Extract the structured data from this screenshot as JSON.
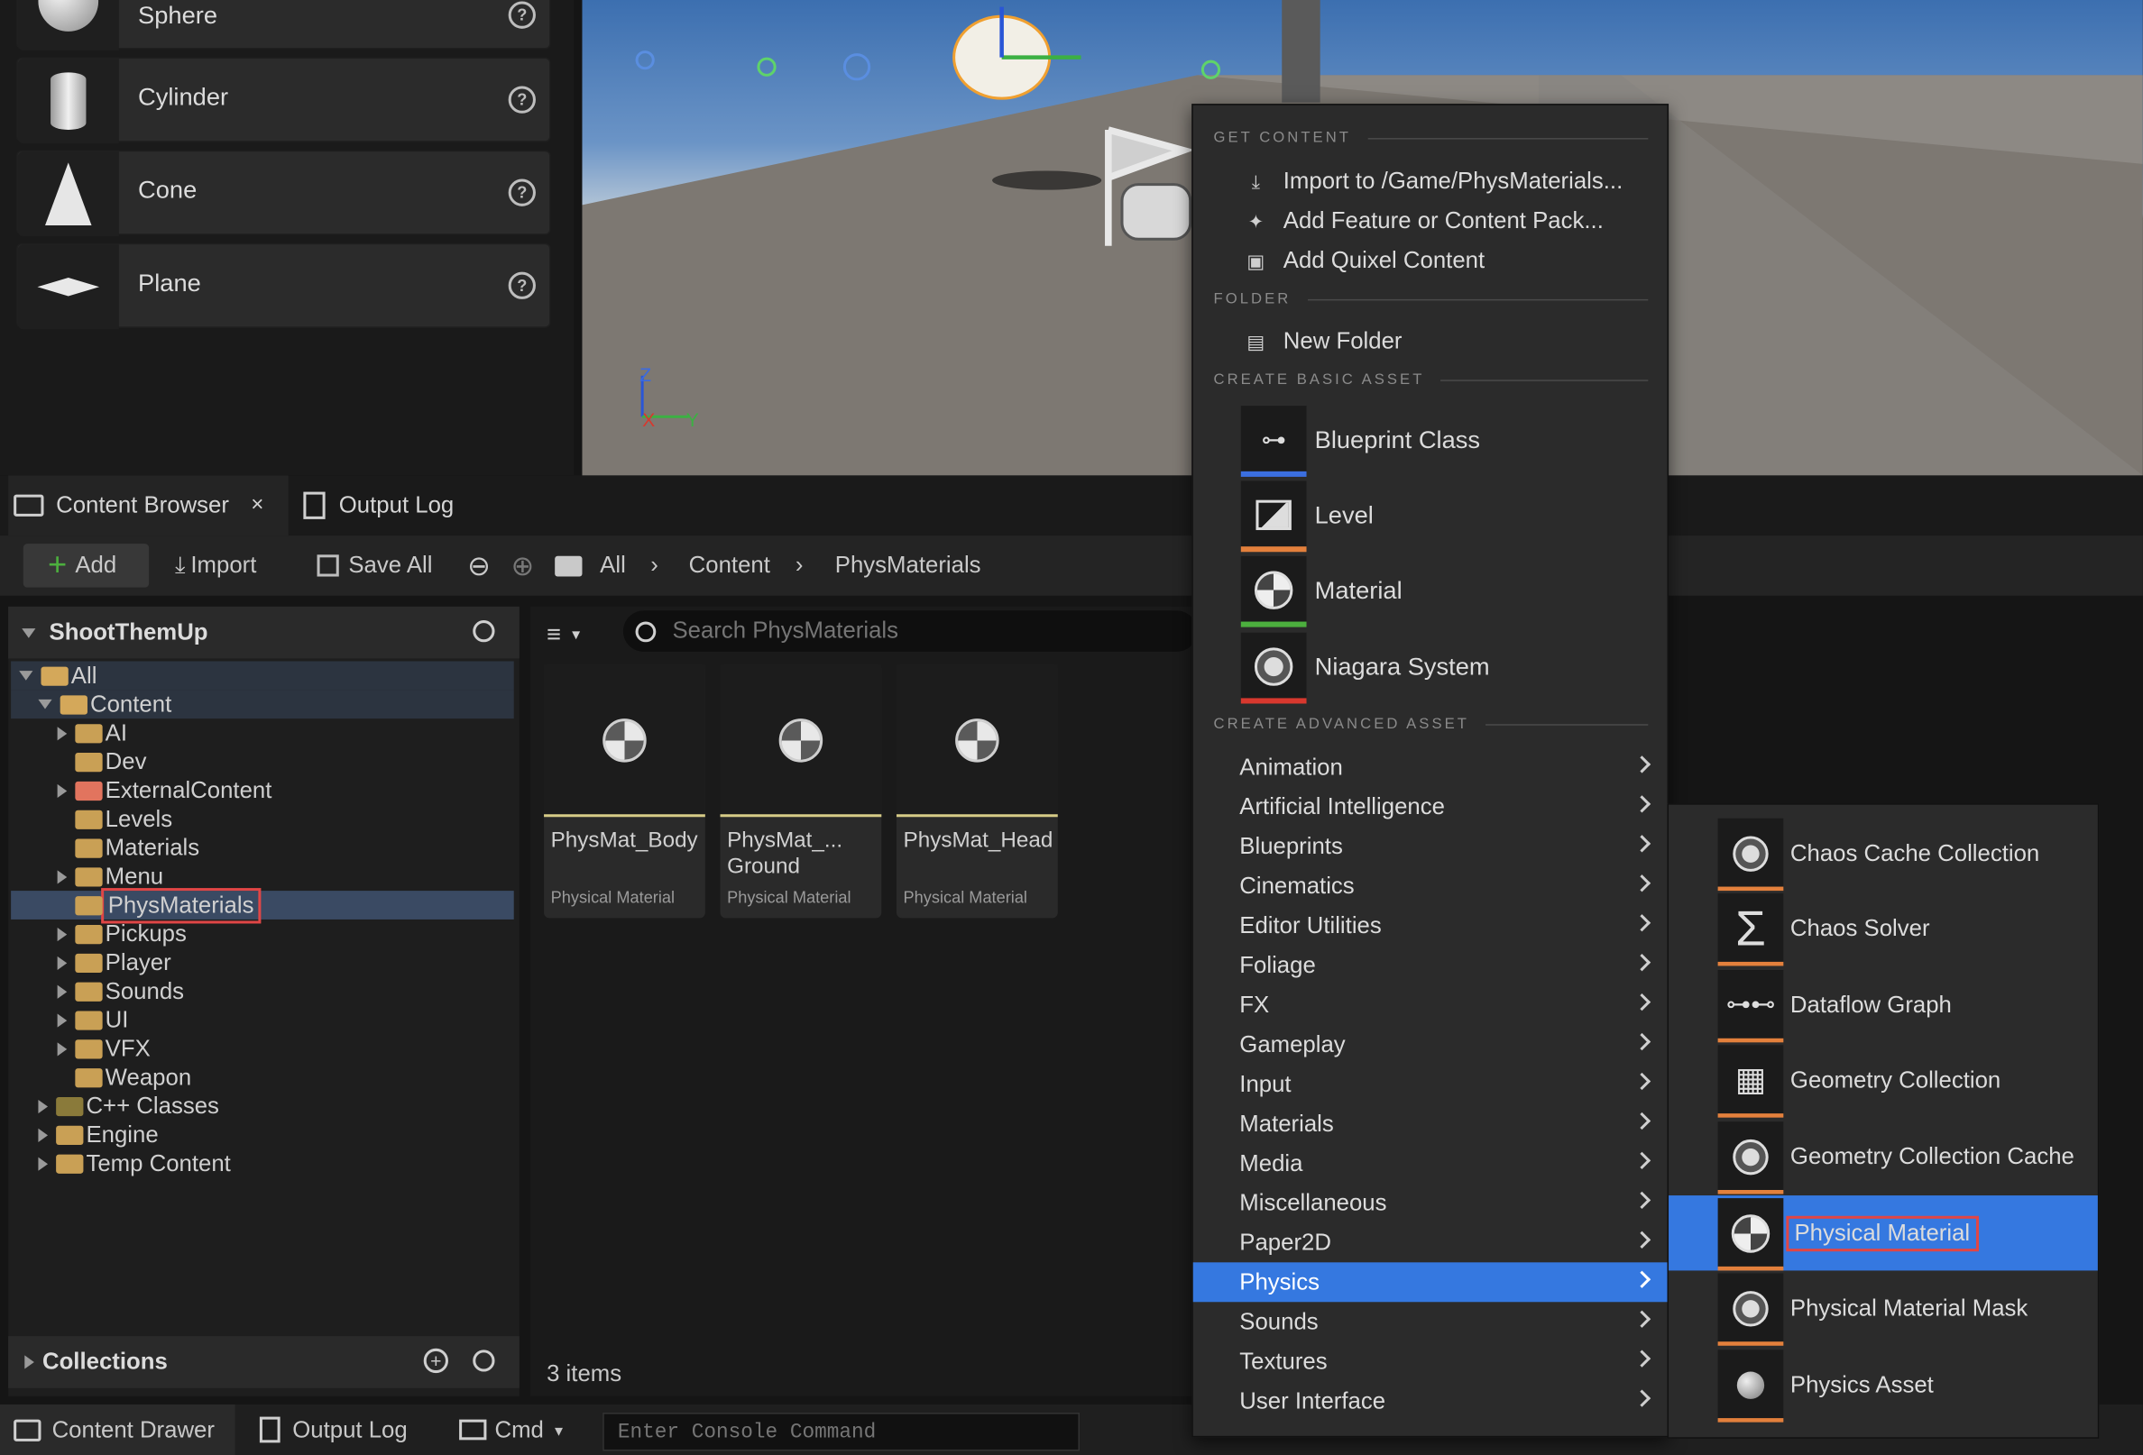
{
  "place_actors": {
    "items": [
      {
        "label": "Sphere",
        "icon": "sphere-icon"
      },
      {
        "label": "Cylinder",
        "icon": "cylinder-icon"
      },
      {
        "label": "Cone",
        "icon": "cone-icon"
      },
      {
        "label": "Plane",
        "icon": "plane-icon"
      }
    ],
    "help_glyph": "?"
  },
  "viewport": {
    "axis": {
      "z": "Z",
      "x": "X",
      "y": "Y"
    }
  },
  "tabs": {
    "content_browser": "Content Browser",
    "close": "×",
    "output_log": "Output Log"
  },
  "toolbar": {
    "add": "Add",
    "import": "Import",
    "save_all": "Save All",
    "breadcrumb": [
      "All",
      "Content",
      "PhysMaterials"
    ]
  },
  "sources": {
    "project": "ShootThemUp",
    "tree": [
      {
        "label": "All",
        "indent": 0
      },
      {
        "label": "Content",
        "indent": 1
      },
      {
        "label": "AI",
        "indent": 2
      },
      {
        "label": "Dev",
        "indent": 2
      },
      {
        "label": "ExternalContent",
        "indent": 2
      },
      {
        "label": "Levels",
        "indent": 2
      },
      {
        "label": "Materials",
        "indent": 2
      },
      {
        "label": "Menu",
        "indent": 2
      },
      {
        "label": "PhysMaterials",
        "indent": 2
      },
      {
        "label": "Pickups",
        "indent": 2
      },
      {
        "label": "Player",
        "indent": 2
      },
      {
        "label": "Sounds",
        "indent": 2
      },
      {
        "label": "UI",
        "indent": 2
      },
      {
        "label": "VFX",
        "indent": 2
      },
      {
        "label": "Weapon",
        "indent": 2
      },
      {
        "label": "C++ Classes",
        "indent": 1
      },
      {
        "label": "Engine",
        "indent": 1
      },
      {
        "label": "Temp Content",
        "indent": 1
      }
    ],
    "collections": "Collections"
  },
  "assets": {
    "search_placeholder": "Search PhysMaterials",
    "items": [
      {
        "name": "PhysMat_Body",
        "type": "Physical Material"
      },
      {
        "name": "PhysMat_...\nGround",
        "type": "Physical Material"
      },
      {
        "name": "PhysMat_Head",
        "type": "Physical Material"
      }
    ],
    "count": "3 items"
  },
  "statusbar": {
    "content_drawer": "Content Drawer",
    "output_log": "Output Log",
    "cmd": "Cmd",
    "console_placeholder": "Enter Console Command"
  },
  "context_menu": {
    "get_content_header": "GET CONTENT",
    "import": "Import to /Game/PhysMaterials...",
    "add_feature": "Add Feature or Content Pack...",
    "add_quixel": "Add Quixel Content",
    "folder_header": "FOLDER",
    "new_folder": "New Folder",
    "basic_header": "CREATE BASIC ASSET",
    "basic": [
      {
        "label": "Blueprint Class",
        "bar": "#3b6fe0"
      },
      {
        "label": "Level",
        "bar": "#e3803c"
      },
      {
        "label": "Material",
        "bar": "#4caf3e"
      },
      {
        "label": "Niagara System",
        "bar": "#d8382e"
      }
    ],
    "advanced_header": "CREATE ADVANCED ASSET",
    "advanced": [
      "Animation",
      "Artificial Intelligence",
      "Blueprints",
      "Cinematics",
      "Editor Utilities",
      "Foliage",
      "FX",
      "Gameplay",
      "Input",
      "Materials",
      "Media",
      "Miscellaneous",
      "Paper2D",
      "Physics",
      "Sounds",
      "Textures",
      "User Interface"
    ]
  },
  "physics_submenu": [
    "Chaos Cache Collection",
    "Chaos Solver",
    "Dataflow Graph",
    "Geometry Collection",
    "Geometry Collection Cache",
    "Physical Material",
    "Physical Material Mask",
    "Physics Asset"
  ],
  "colors": {
    "accent": "#3578e0",
    "highlight_box": "#e04646"
  }
}
